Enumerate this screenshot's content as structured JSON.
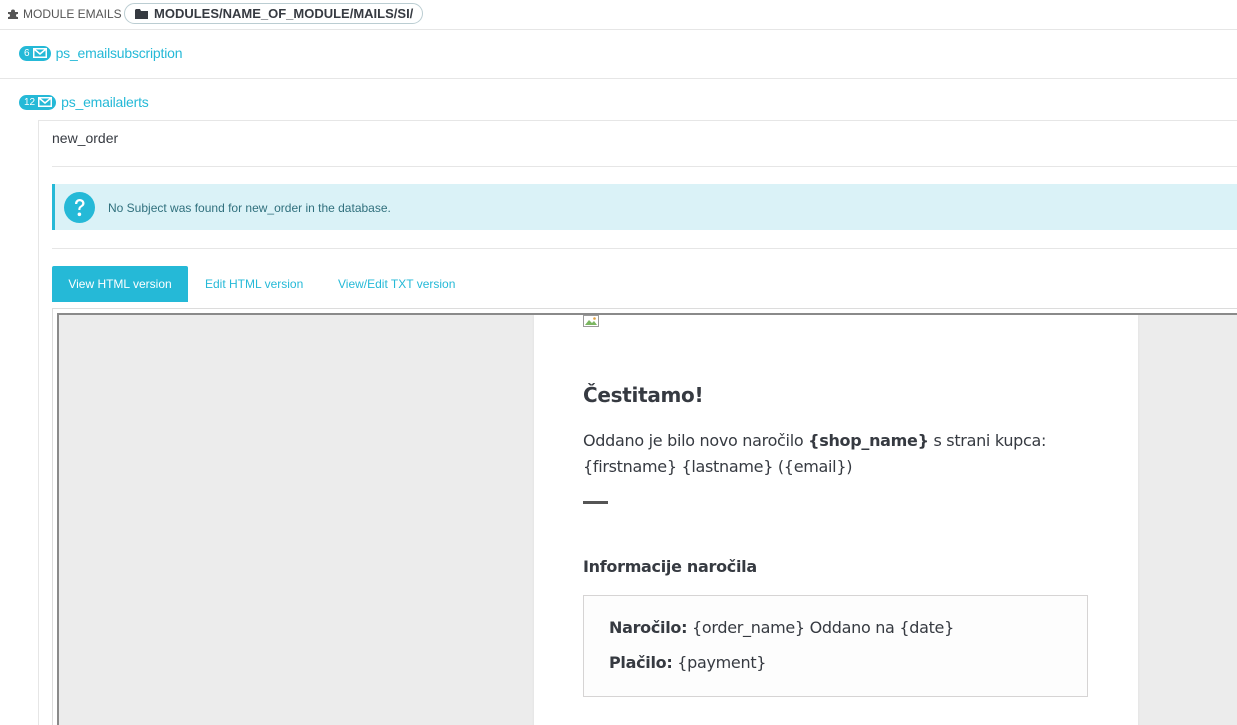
{
  "header": {
    "section_title": "MODULE EMAILS",
    "path": "MODULES/NAME_OF_MODULE/MAILS/SI/"
  },
  "modules": [
    {
      "count": "6",
      "name": "ps_emailsubscription"
    },
    {
      "count": "12",
      "name": "ps_emailalerts"
    }
  ],
  "template": {
    "name": "new_order",
    "alert": "No Subject was found for new_order in the database."
  },
  "tabs": [
    {
      "label": "View HTML version",
      "active": true
    },
    {
      "label": "Edit HTML version",
      "active": false
    },
    {
      "label": "View/Edit TXT version",
      "active": false
    }
  ],
  "email_preview": {
    "greeting": "Čestitamo!",
    "intro_before": "Oddano je bilo novo naročilo ",
    "intro_bold": "{shop_name}",
    "intro_after": " s strani kupca: {firstname} {lastname} ({email})",
    "section_title": "Informacije naročila",
    "order_label": "Naročilo:",
    "order_value": " {order_name} Oddano na {date}",
    "payment_label": "Plačilo:",
    "payment_value": " {payment}"
  },
  "colors": {
    "accent": "#25b9d7",
    "alert_bg": "#daf2f7",
    "text": "#363a41"
  },
  "icons": {
    "module": "puzzle-icon",
    "folder": "folder-icon",
    "mail": "envelope-icon",
    "help": "question-circle-icon",
    "image": "broken-image-icon"
  }
}
